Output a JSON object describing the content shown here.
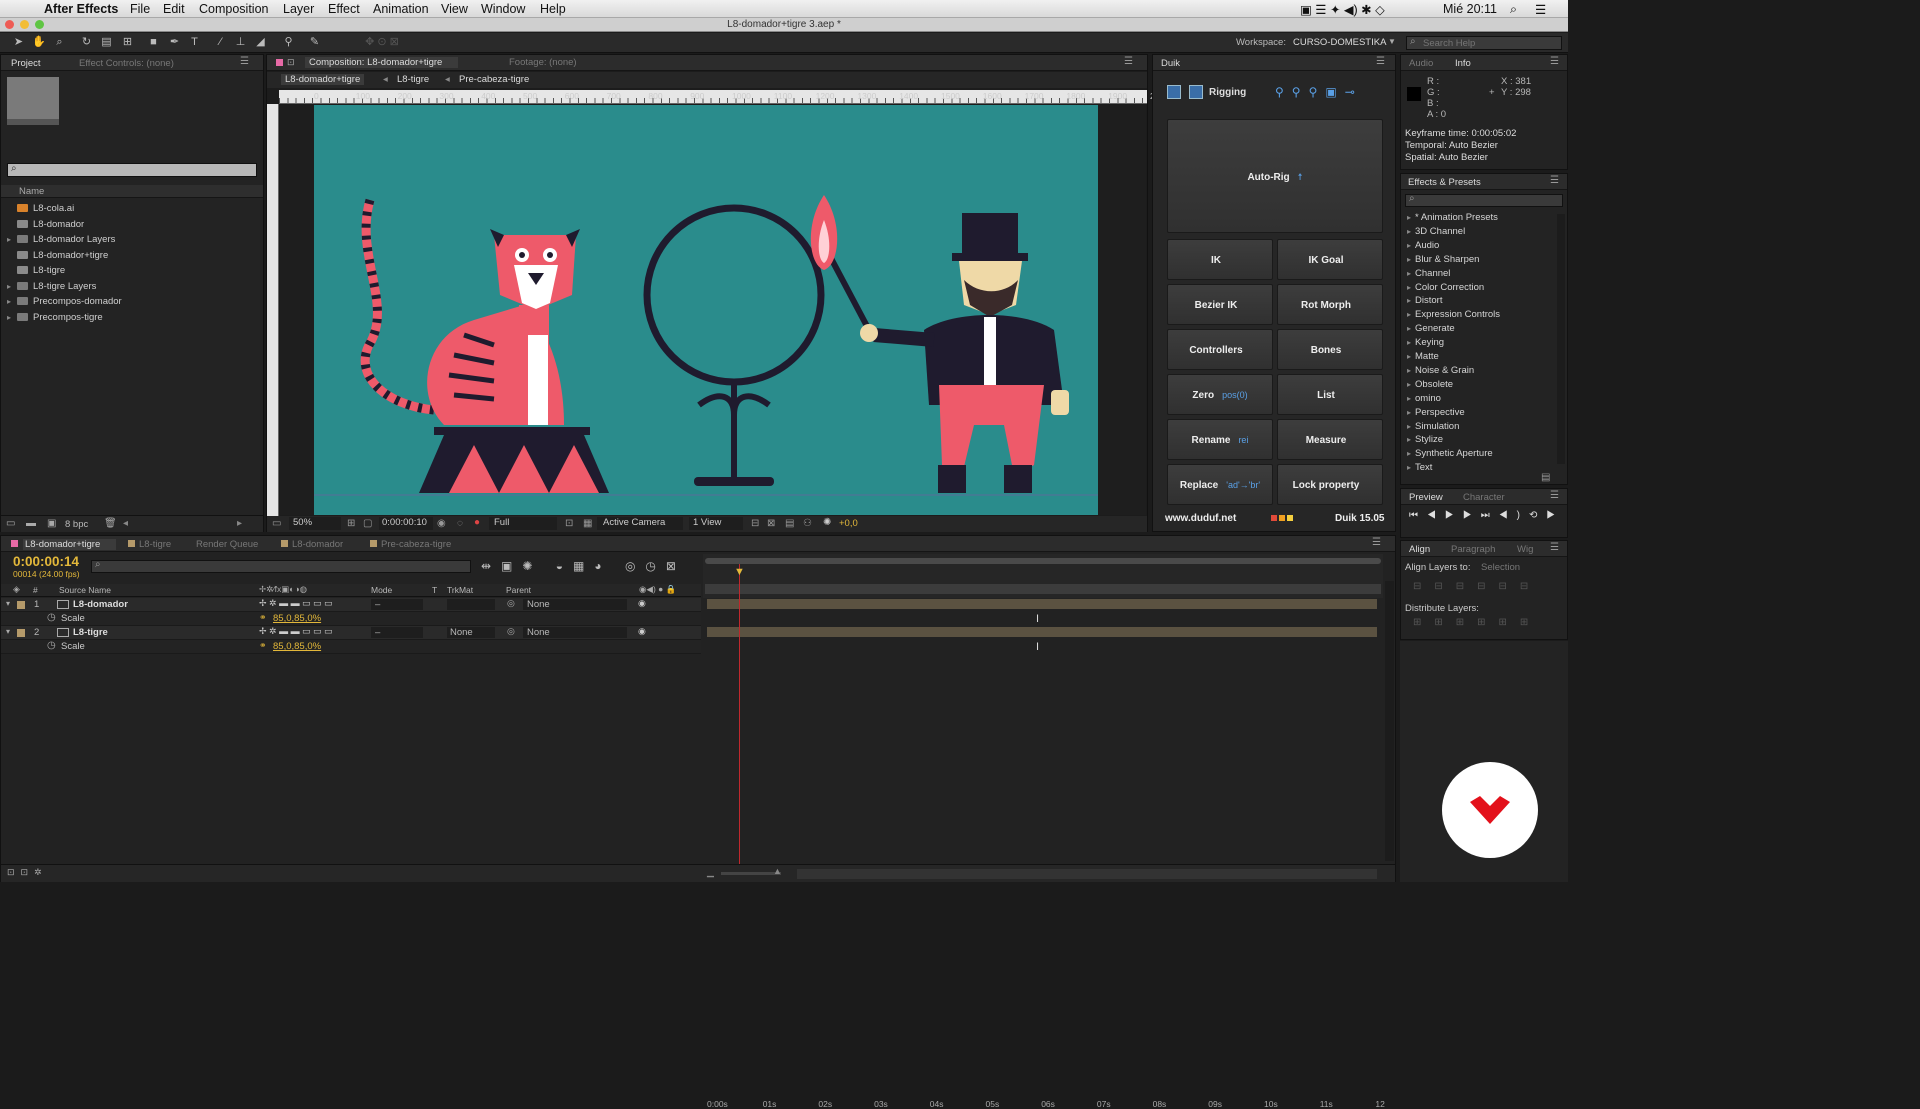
{
  "menubar": {
    "app": "After Effects",
    "items": [
      "File",
      "Edit",
      "Composition",
      "Layer",
      "Effect",
      "Animation",
      "View",
      "Window",
      "Help"
    ],
    "clock": "Mié 20:11"
  },
  "titlebar": {
    "title": "L8-domador+tigre 3.aep *"
  },
  "toolbar": {
    "workspace_label": "Workspace:",
    "workspace_value": "CURSO-DOMESTIKA",
    "search_placeholder": "Search Help"
  },
  "project": {
    "tabs": [
      "Project",
      "Effect Controls: (none)"
    ],
    "column": "Name",
    "items": [
      {
        "name": "L8-cola.ai",
        "kind": "ai",
        "expand": false
      },
      {
        "name": "L8-domador",
        "kind": "comp",
        "expand": false
      },
      {
        "name": "L8-domador Layers",
        "kind": "folder",
        "expand": true
      },
      {
        "name": "L8-domador+tigre",
        "kind": "comp",
        "expand": false
      },
      {
        "name": "L8-tigre",
        "kind": "comp",
        "expand": false
      },
      {
        "name": "L8-tigre Layers",
        "kind": "folder",
        "expand": true
      },
      {
        "name": "Precompos-domador",
        "kind": "folder",
        "expand": true
      },
      {
        "name": "Precompos-tigre",
        "kind": "folder",
        "expand": true
      }
    ],
    "bpc": "8 bpc"
  },
  "composition": {
    "tab": "Composition: L8-domador+tigre",
    "footage_tab": "Footage: (none)",
    "breadcrumbs": [
      "L8-domador+tigre",
      "L8-tigre",
      "Pre-cabeza-tigre"
    ],
    "ruler": [
      "0",
      "100",
      "200",
      "300",
      "400",
      "500",
      "600",
      "700",
      "800",
      "900",
      "1000",
      "1100",
      "1200",
      "1300",
      "1400",
      "1500",
      "1600",
      "1700",
      "1800",
      "1900",
      "200"
    ],
    "zoom": "50%",
    "timecode": "0:00:00:10",
    "resolution": "Full",
    "camera": "Active Camera",
    "views": "1 View",
    "exposure": "+0,0"
  },
  "duik": {
    "tab": "Duik",
    "section": "Rigging",
    "autorig": "Auto-Rig",
    "buttons": [
      {
        "label": "IK",
        "sub": ""
      },
      {
        "label": "IK Goal",
        "sub": ""
      },
      {
        "label": "Bezier IK",
        "sub": ""
      },
      {
        "label": "Rot Morph",
        "sub": ""
      },
      {
        "label": "Controllers",
        "sub": ""
      },
      {
        "label": "Bones",
        "sub": ""
      },
      {
        "label": "Zero",
        "sub": "pos(0)"
      },
      {
        "label": "List",
        "sub": ""
      },
      {
        "label": "Rename",
        "sub": "rei"
      },
      {
        "label": "Measure",
        "sub": ""
      },
      {
        "label": "Replace",
        "sub": "'ad'→'br'"
      },
      {
        "label": "Lock property",
        "sub": ""
      }
    ],
    "website": "www.duduf.net",
    "version": "Duik 15.05"
  },
  "info": {
    "tabs": [
      "Audio",
      "Info"
    ],
    "r": "R :",
    "g": "G :",
    "b": "B :",
    "a": "A : 0",
    "x": "X : 381",
    "y": "Y : 298",
    "lines": [
      "Keyframe time: 0:00:05:02",
      "Temporal: Auto Bezier",
      "Spatial: Auto Bezier"
    ]
  },
  "effects": {
    "tab": "Effects & Presets",
    "items": [
      "* Animation Presets",
      "3D Channel",
      "Audio",
      "Blur & Sharpen",
      "Channel",
      "Color Correction",
      "Distort",
      "Expression Controls",
      "Generate",
      "Keying",
      "Matte",
      "Noise & Grain",
      "Obsolete",
      "omino",
      "Perspective",
      "Simulation",
      "Stylize",
      "Synthetic Aperture",
      "Text"
    ]
  },
  "preview": {
    "tabs": [
      "Preview",
      "Character"
    ]
  },
  "align": {
    "tabs": [
      "Align",
      "Paragraph",
      "Wig"
    ],
    "align_to_label": "Align Layers to:",
    "align_to_value": "Selection",
    "distribute": "Distribute Layers:"
  },
  "timeline": {
    "tabs": [
      "L8-domador+tigre",
      "L8-tigre",
      "Render Queue",
      "L8-domador",
      "Pre-cabeza-tigre"
    ],
    "timecode": "0:00:00:14",
    "frames": "00014 (24.00 fps)",
    "columns": {
      "num": "#",
      "source": "Source Name",
      "mode": "Mode",
      "t": "T",
      "trkmat": "TrkMat",
      "parent": "Parent"
    },
    "ticks": [
      "0:00s",
      "01s",
      "02s",
      "03s",
      "04s",
      "05s",
      "06s",
      "07s",
      "08s",
      "09s",
      "10s",
      "11s",
      "12"
    ],
    "layers": [
      {
        "num": "1",
        "name": "L8-domador",
        "mode": "–",
        "trkmat": "",
        "parent": "None",
        "prop": "Scale",
        "value": "85,0,85,0%"
      },
      {
        "num": "2",
        "name": "L8-tigre",
        "mode": "–",
        "trkmat": "None",
        "parent": "None",
        "prop": "Scale",
        "value": "85,0,85,0%"
      }
    ]
  },
  "colors": {
    "accent": "#e3b83a",
    "canvas": "#2a8c8c",
    "pink": "#ee5a6a",
    "navy": "#1f1b2e",
    "playhead": "#c0282d"
  }
}
